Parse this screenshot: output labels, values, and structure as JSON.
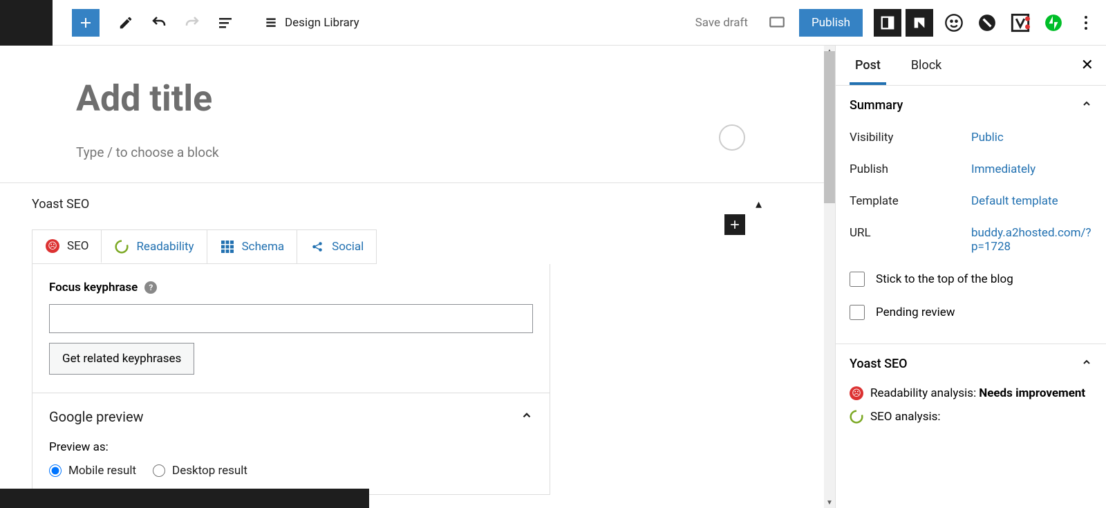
{
  "toolbar": {
    "design_library": "Design Library",
    "save_draft": "Save draft",
    "publish": "Publish"
  },
  "editor": {
    "title_placeholder": "Add title",
    "block_prompt": "Type / to choose a block"
  },
  "yoast": {
    "title": "Yoast SEO",
    "tabs": {
      "seo": "SEO",
      "readability": "Readability",
      "schema": "Schema",
      "social": "Social"
    },
    "focus_label": "Focus keyphrase",
    "related_btn": "Get related keyphrases",
    "google_preview": "Google preview",
    "preview_as": "Preview as:",
    "mobile": "Mobile result",
    "desktop": "Desktop result"
  },
  "sidebar": {
    "tabs": {
      "post": "Post",
      "block": "Block"
    },
    "summary": {
      "title": "Summary",
      "visibility_l": "Visibility",
      "visibility_v": "Public",
      "publish_l": "Publish",
      "publish_v": "Immediately",
      "template_l": "Template",
      "template_v": "Default template",
      "url_l": "URL",
      "url_v": "buddy.a2hosted.com/?p=1728",
      "stick": "Stick to the top of the blog",
      "pending": "Pending review"
    },
    "yoast": {
      "title": "Yoast SEO",
      "readability": "Readability analysis: ",
      "readability_status": "Needs improvement",
      "seo": "SEO analysis:"
    }
  }
}
